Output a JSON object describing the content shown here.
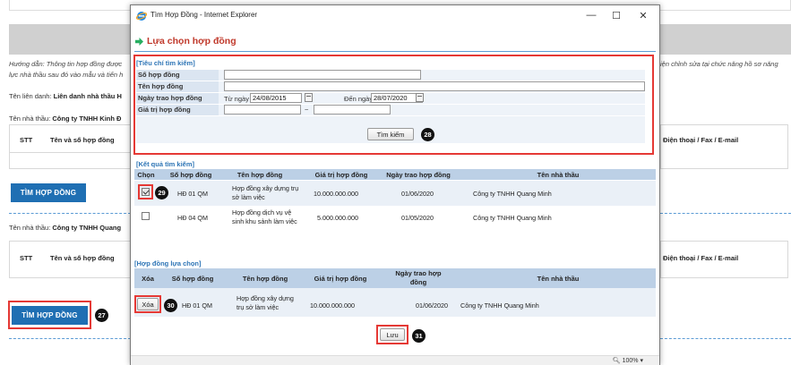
{
  "background": {
    "hint": "Hướng dẫn: Thông tin hợp đồng được",
    "hint_line2": "lực nhà thầu sau đó vào mẫu và tiến h",
    "hint_right": "iện chỉnh sửa tại chức năng hồ sơ năng",
    "consortium_label": "Tên liên danh:",
    "consortium_value": "Liên danh nhà thầu H",
    "contractor1_label": "Tên nhà thầu:",
    "contractor1_value": "Công ty TNHH Kinh Đ",
    "contractor2_label": "Tên nhà thầu:",
    "contractor2_value": "Công ty TNHH Quang",
    "col_stt": "STT",
    "col_name": "Tên và số hợp đồng",
    "col_phone": "Điện thoại / Fax / E-mail",
    "find_button": "TÌM HỢP ĐỒNG",
    "find_button2": "TÌM HỢP ĐỒNG"
  },
  "window": {
    "title": "Tìm Hợp Đồng - Internet Explorer",
    "minimize": "—",
    "maximize": "☐",
    "close": "✕",
    "zoom": "100%"
  },
  "page": {
    "heading": "Lựa chọn hợp đồng"
  },
  "search": {
    "section_title": "[Tiêu chí tìm kiếm]",
    "contract_no_label": "Số hợp đồng",
    "contract_no_value": "",
    "contract_name_label": "Tên hợp đồng",
    "contract_name_value": "",
    "date_label": "Ngày trao hợp đồng",
    "from_label": "Từ ngày",
    "from_value": "24/08/2015",
    "to_label": "Đến ngày",
    "to_value": "28/07/2020",
    "value_label": "Giá trị hợp đồng",
    "value_from": "",
    "value_sep": "~",
    "value_to": "",
    "search_button": "Tìm kiếm"
  },
  "results": {
    "section_title": "[Kết quả tìm kiếm]",
    "headers": [
      "Chọn",
      "Số hợp đồng",
      "Tên hợp đồng",
      "Giá trị hợp đồng",
      "Ngày trao hợp đồng",
      "Tên nhà thầu"
    ],
    "rows": [
      {
        "checked": true,
        "no": "HĐ 01 QM",
        "name_l1": "Hợp đồng xây dựng trụ",
        "name_l2": "sở làm việc",
        "value": "10.000.000.000",
        "date": "01/06/2020",
        "contractor": "Công ty TNHH Quang Minh"
      },
      {
        "checked": false,
        "no": "HĐ 04 QM",
        "name_l1": "Hợp đồng dịch vụ vệ",
        "name_l2": "sinh khu sảnh làm việc",
        "value": "5.000.000.000",
        "date": "01/05/2020",
        "contractor": "Công ty TNHH Quang Minh"
      }
    ]
  },
  "selected": {
    "section_title": "[Hợp đồng lựa chọn]",
    "headers": [
      "Xóa",
      "Số hợp đồng",
      "Tên hợp đồng",
      "Giá trị hợp đồng",
      "Ngày trao hợp",
      "đồng",
      "Tên nhà thầu"
    ],
    "rows": [
      {
        "delete": "Xóa",
        "no": "HĐ 01 QM",
        "name_l1": "Hợp đồng xây dựng",
        "name_l2": "trụ sở làm việc",
        "value": "10.000.000.000",
        "date": "01/06/2020",
        "contractor": "Công ty TNHH Quang Minh"
      }
    ],
    "save_button": "Lưu"
  },
  "badges": [
    "27",
    "28",
    "29",
    "30",
    "31"
  ],
  "colors": {
    "accent": "#1f6fb3",
    "heading": "#c0392b",
    "annotation": "#e53935",
    "section": "#2e75b6"
  }
}
